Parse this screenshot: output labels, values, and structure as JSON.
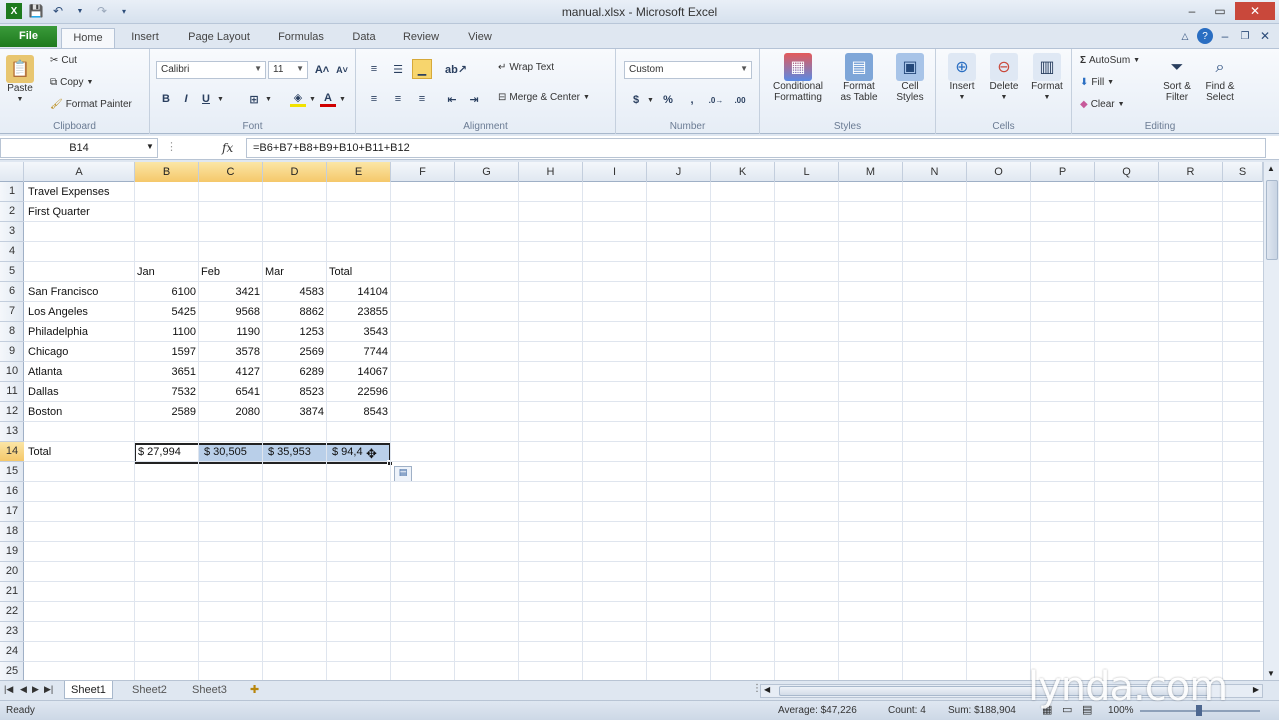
{
  "window": {
    "title": "manual.xlsx - Microsoft Excel"
  },
  "ribbon_tabs": [
    {
      "label": "File"
    },
    {
      "label": "Home"
    },
    {
      "label": "Insert"
    },
    {
      "label": "Page Layout"
    },
    {
      "label": "Formulas"
    },
    {
      "label": "Data"
    },
    {
      "label": "Review"
    },
    {
      "label": "View"
    }
  ],
  "clipboard": {
    "paste": "Paste",
    "cut": "Cut",
    "copy": "Copy",
    "format_painter": "Format Painter",
    "label": "Clipboard"
  },
  "font": {
    "name": "Calibri",
    "size": "11",
    "label": "Font",
    "bold": "B",
    "italic": "I",
    "underline": "U"
  },
  "alignment": {
    "wrap_text": "Wrap Text",
    "merge_center": "Merge & Center",
    "label": "Alignment"
  },
  "number": {
    "format": "Custom",
    "currency": "$",
    "percent": "%",
    "comma": ",",
    "label": "Number"
  },
  "styles": {
    "conditional": [
      "Conditional",
      "Formatting"
    ],
    "format_table": [
      "Format",
      "as Table"
    ],
    "cell_styles": [
      "Cell",
      "Styles"
    ],
    "label": "Styles"
  },
  "cells_group": {
    "insert": "Insert",
    "delete": "Delete",
    "format": "Format",
    "label": "Cells"
  },
  "editing": {
    "autosum": "AutoSum",
    "fill": "Fill",
    "clear": "Clear",
    "sort_filter": [
      "Sort &",
      "Filter"
    ],
    "find_select": [
      "Find &",
      "Select"
    ],
    "label": "Editing"
  },
  "formula_bar": {
    "name_box": "B14",
    "fx": "fx",
    "formula": "=B6+B7+B8+B9+B10+B11+B12"
  },
  "columns": [
    "A",
    "B",
    "C",
    "D",
    "E",
    "F",
    "G",
    "H",
    "I",
    "J",
    "K",
    "L",
    "M",
    "N",
    "O",
    "P",
    "Q",
    "R",
    "S"
  ],
  "rows": [
    "1",
    "2",
    "3",
    "4",
    "5",
    "6",
    "7",
    "8",
    "9",
    "10",
    "11",
    "12",
    "13",
    "14",
    "15",
    "16",
    "17",
    "18",
    "19",
    "20",
    "21",
    "22",
    "23",
    "24",
    "25"
  ],
  "sheet": {
    "a1": "Travel Expenses",
    "a2": "First Quarter",
    "headers": [
      "Jan",
      "Feb",
      "Mar",
      "Total"
    ],
    "data": [
      {
        "city": "San Francisco",
        "jan": "6100",
        "feb": "3421",
        "mar": "4583",
        "total": "14104"
      },
      {
        "city": "Los Angeles",
        "jan": "5425",
        "feb": "9568",
        "mar": "8862",
        "total": "23855"
      },
      {
        "city": "Philadelphia",
        "jan": "1100",
        "feb": "1190",
        "mar": "1253",
        "total": "3543"
      },
      {
        "city": "Chicago",
        "jan": "1597",
        "feb": "3578",
        "mar": "2569",
        "total": "7744"
      },
      {
        "city": "Atlanta",
        "jan": "3651",
        "feb": "4127",
        "mar": "6289",
        "total": "14067"
      },
      {
        "city": "Dallas",
        "jan": "7532",
        "feb": "6541",
        "mar": "8523",
        "total": "22596"
      },
      {
        "city": "Boston",
        "jan": "2589",
        "feb": "2080",
        "mar": "3874",
        "total": "8543"
      }
    ],
    "total_label": "Total",
    "totals": [
      "$ 27,994",
      "$ 30,505",
      "$ 35,953",
      "$ 94,4"
    ]
  },
  "sheet_tabs": [
    "Sheet1",
    "Sheet2",
    "Sheet3"
  ],
  "status": {
    "ready": "Ready",
    "average": "Average: $47,226",
    "count": "Count: 4",
    "sum": "Sum: $188,904",
    "zoom": "100%"
  },
  "watermark": "lynda.com",
  "colors": {
    "file_tab": "#1e7a1e",
    "selected_header": "#f5c86a",
    "selection_fill": "#b9cfe9"
  }
}
